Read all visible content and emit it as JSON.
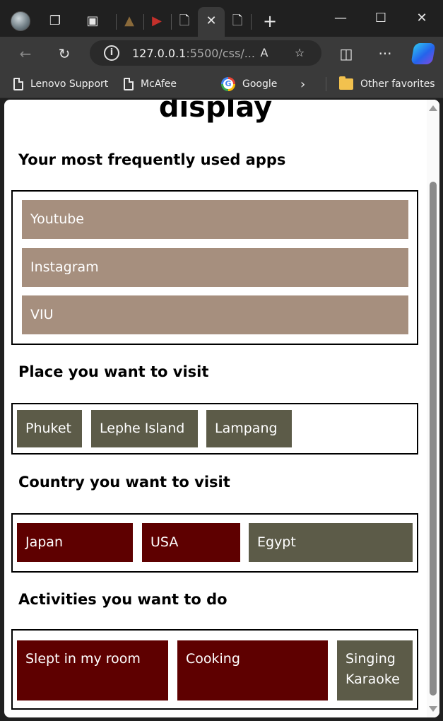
{
  "browser": {
    "url_host": "127.0.0.1",
    "url_rest": ":5500/css/...",
    "favorites": [
      "Lenovo Support",
      "McAfee",
      "Google"
    ],
    "other_favorites": "Other favorites"
  },
  "page": {
    "title": "display",
    "sections": [
      {
        "heading": "Your most frequently used apps",
        "items": [
          "Youtube",
          "Instagram",
          "VIU"
        ]
      },
      {
        "heading": "Place you want to visit",
        "items": [
          "Phuket",
          "Lephe Island",
          "Lampang"
        ]
      },
      {
        "heading": "Country you want to visit",
        "items": [
          "Japan",
          "USA",
          "Egypt"
        ]
      },
      {
        "heading": "Activities you want to do",
        "items": [
          "Slept in my room",
          "Cooking",
          "Singing Karaoke"
        ]
      }
    ]
  },
  "colors": {
    "tan": "#a68f7e",
    "olive": "#5c5b48",
    "maroon": "#5e0000"
  }
}
